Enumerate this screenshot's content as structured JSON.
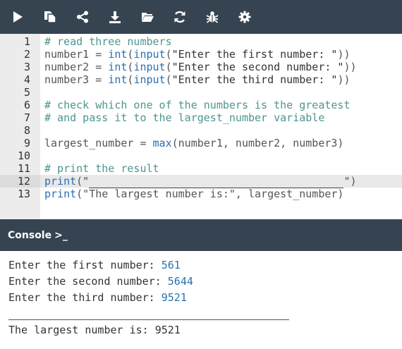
{
  "toolbar": {
    "buttons": [
      {
        "name": "run",
        "icon": "play-icon"
      },
      {
        "name": "copy",
        "icon": "copy-icon"
      },
      {
        "name": "share",
        "icon": "share-icon"
      },
      {
        "name": "download",
        "icon": "download-icon"
      },
      {
        "name": "open",
        "icon": "folder-open-icon"
      },
      {
        "name": "reset",
        "icon": "refresh-icon"
      },
      {
        "name": "debug",
        "icon": "bug-icon"
      },
      {
        "name": "settings",
        "icon": "gear-icon"
      }
    ]
  },
  "editor": {
    "active_line": 12,
    "lines": [
      {
        "n": "1",
        "parts": [
          {
            "t": "cm",
            "v": "# read three numbers"
          }
        ]
      },
      {
        "n": "2",
        "parts": [
          {
            "t": "fn",
            "v": "number1 = "
          },
          {
            "t": "kw",
            "v": "int"
          },
          {
            "t": "fn",
            "v": "("
          },
          {
            "t": "kw",
            "v": "input"
          },
          {
            "t": "fn",
            "v": "("
          },
          {
            "t": "str",
            "v": "\"Enter the first number: \""
          },
          {
            "t": "fn",
            "v": "))"
          }
        ]
      },
      {
        "n": "3",
        "parts": [
          {
            "t": "fn",
            "v": "number2 = "
          },
          {
            "t": "kw",
            "v": "int"
          },
          {
            "t": "fn",
            "v": "("
          },
          {
            "t": "kw",
            "v": "input"
          },
          {
            "t": "fn",
            "v": "("
          },
          {
            "t": "str",
            "v": "\"Enter the second number: \""
          },
          {
            "t": "fn",
            "v": "))"
          }
        ]
      },
      {
        "n": "4",
        "parts": [
          {
            "t": "fn",
            "v": "number3 = "
          },
          {
            "t": "kw",
            "v": "int"
          },
          {
            "t": "fn",
            "v": "("
          },
          {
            "t": "kw",
            "v": "input"
          },
          {
            "t": "fn",
            "v": "("
          },
          {
            "t": "str",
            "v": "\"Enter the third number: \""
          },
          {
            "t": "fn",
            "v": "))"
          }
        ]
      },
      {
        "n": "5",
        "parts": []
      },
      {
        "n": "6",
        "parts": [
          {
            "t": "cm",
            "v": "# check which one of the numbers is the greatest"
          }
        ]
      },
      {
        "n": "7",
        "parts": [
          {
            "t": "cm",
            "v": "# and pass it to the largest_number variable"
          }
        ]
      },
      {
        "n": "8",
        "parts": []
      },
      {
        "n": "9",
        "parts": [
          {
            "t": "fn",
            "v": "largest_number = "
          },
          {
            "t": "kw",
            "v": "max"
          },
          {
            "t": "fn",
            "v": "(number1, number2, number3)"
          }
        ]
      },
      {
        "n": "10",
        "parts": []
      },
      {
        "n": "11",
        "parts": [
          {
            "t": "cm",
            "v": "# print the result"
          }
        ]
      },
      {
        "n": "12",
        "parts": [
          {
            "t": "kw",
            "v": "print"
          },
          {
            "t": "fn",
            "v": "(\""
          },
          {
            "t": "blank",
            "v": "                                        "
          },
          {
            "t": "fn",
            "v": "\")"
          }
        ]
      },
      {
        "n": "13",
        "parts": [
          {
            "t": "kw",
            "v": "print"
          },
          {
            "t": "fn",
            "v": "(\"The largest number is:\", largest_number)"
          }
        ]
      }
    ]
  },
  "console": {
    "title": "Console",
    "prompt_glyph": ">_",
    "lines": [
      {
        "prompt": "Enter the first number: ",
        "input": "561"
      },
      {
        "prompt": "Enter the second number: ",
        "input": "5644"
      },
      {
        "prompt": "Enter the third number: ",
        "input": "9521"
      }
    ],
    "result": "The largest number is: 9521"
  },
  "colors": {
    "toolbar_bg": "#364452",
    "comment": "#4d9690",
    "keyword": "#2a6fb2",
    "input": "#2a6fb2"
  }
}
